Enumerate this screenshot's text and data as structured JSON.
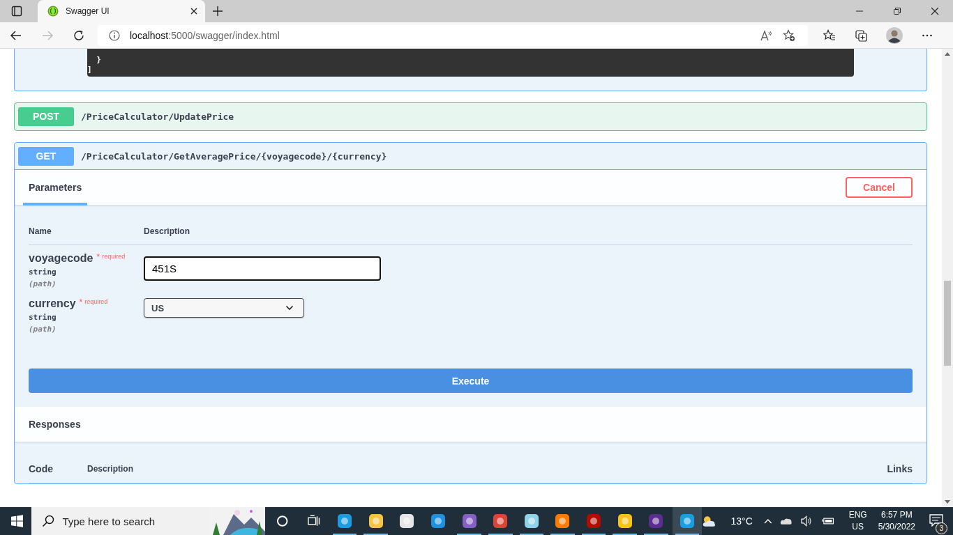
{
  "browser": {
    "tab_title": "Swagger UI",
    "url_host": "localhost",
    "url_path": ":5000/swagger/index.html"
  },
  "code_block": {
    "lines": [
      "  }",
      "]"
    ]
  },
  "operations": [
    {
      "method": "POST",
      "path": "/PriceCalculator/UpdatePrice",
      "expanded": false
    },
    {
      "method": "GET",
      "path": "/PriceCalculator/GetAveragePrice/{voyagecode}/{currency}",
      "expanded": true
    }
  ],
  "parameters_section": {
    "tab": "Parameters",
    "cancel": "Cancel",
    "columns": [
      "Name",
      "Description"
    ],
    "params": [
      {
        "name": "voyagecode",
        "required_mark": "*",
        "required": "required",
        "type": "string",
        "location": "(path)",
        "kind": "text",
        "value": "451S"
      },
      {
        "name": "currency",
        "required_mark": "*",
        "required": "required",
        "type": "string",
        "location": "(path)",
        "kind": "select",
        "value": "US"
      }
    ]
  },
  "execute": "Execute",
  "responses": {
    "title": "Responses",
    "columns": [
      "Code",
      "Description",
      "Links"
    ]
  },
  "taskbar": {
    "search_placeholder": "Type here to search",
    "weather": "13°C",
    "language": "ENG",
    "region": "US",
    "time": "6:57 PM",
    "date": "5/30/2022",
    "notifications": "3"
  }
}
